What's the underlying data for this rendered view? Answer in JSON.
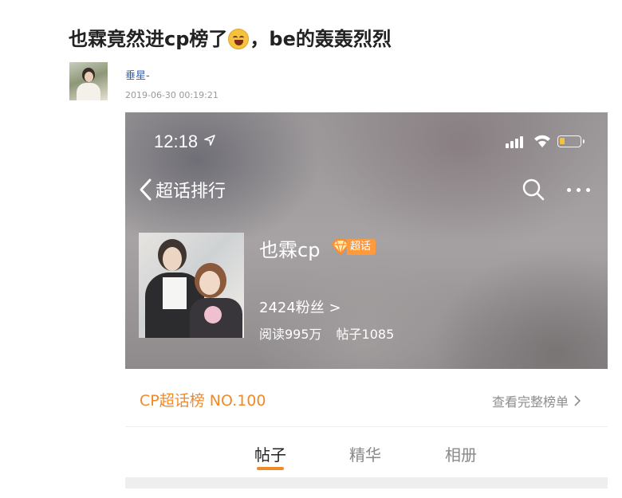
{
  "post": {
    "title_prefix": "也霖竟然进cp榜了",
    "title_suffix": "，be的轰轰烈烈",
    "emoji": "laughing-tears-emoji",
    "username": "垂星-",
    "timestamp": "2019-06-30 00:19:21"
  },
  "screenshot": {
    "status_bar": {
      "time": "12:18",
      "battery_color": "#f5c33b"
    },
    "nav": {
      "back_label": "超话排行",
      "icons": [
        "chevron-left-icon",
        "search-icon",
        "more-icon"
      ]
    },
    "topic": {
      "name": "也霖cp",
      "badge": "超话",
      "fans": "2424粉丝 >",
      "reads": "阅读995万",
      "posts": "帖子1085"
    },
    "rank": {
      "label": "CP超话榜 NO.100",
      "view_all": "查看完整榜单"
    },
    "tabs": [
      {
        "label": "帖子",
        "active": true
      },
      {
        "label": "精华",
        "active": false
      },
      {
        "label": "相册",
        "active": false
      }
    ],
    "accent_color": "#f08a28"
  }
}
